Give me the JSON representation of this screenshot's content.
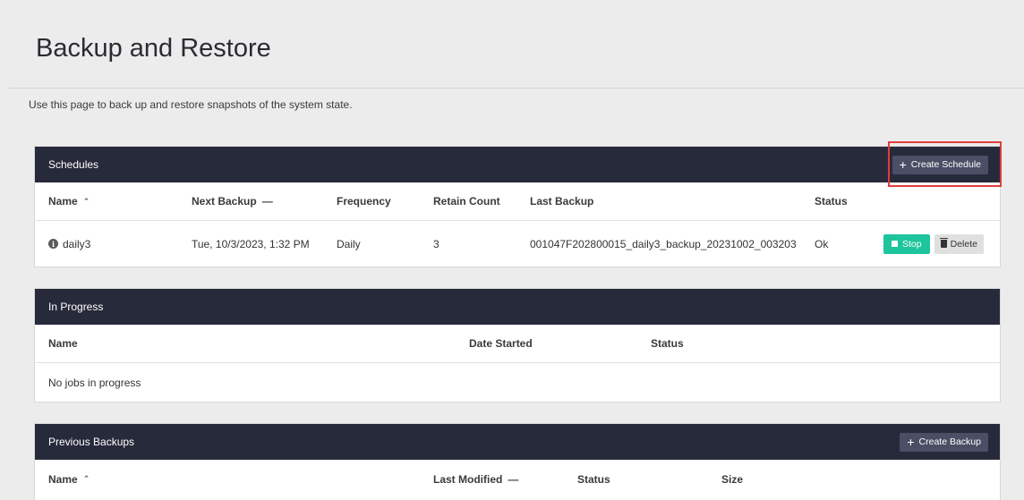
{
  "page": {
    "title": "Backup and Restore",
    "description": "Use this page to back up and restore snapshots of the system state."
  },
  "schedules": {
    "title": "Schedules",
    "create_label": "Create Schedule",
    "columns": [
      "Name",
      "Next Backup",
      "Frequency",
      "Retain Count",
      "Last Backup",
      "Status"
    ],
    "rows": [
      {
        "name": "daily3",
        "next_backup": "Tue, 10/3/2023, 1:32 PM",
        "frequency": "Daily",
        "retain_count": "3",
        "last_backup": "001047F202800015_daily3_backup_20231002_003203",
        "status": "Ok",
        "stop_label": "Stop",
        "delete_label": "Delete"
      }
    ]
  },
  "in_progress": {
    "title": "In Progress",
    "columns": [
      "Name",
      "Date Started",
      "Status"
    ],
    "empty_text": "No jobs in progress"
  },
  "previous_backups": {
    "title": "Previous Backups",
    "create_label": "Create Backup",
    "columns": [
      "Name",
      "Last Modified",
      "Status",
      "Size"
    ]
  },
  "colors": {
    "panel_header": "#272a3b",
    "stop_button": "#1ec49c",
    "highlight": "#e13c3c"
  }
}
